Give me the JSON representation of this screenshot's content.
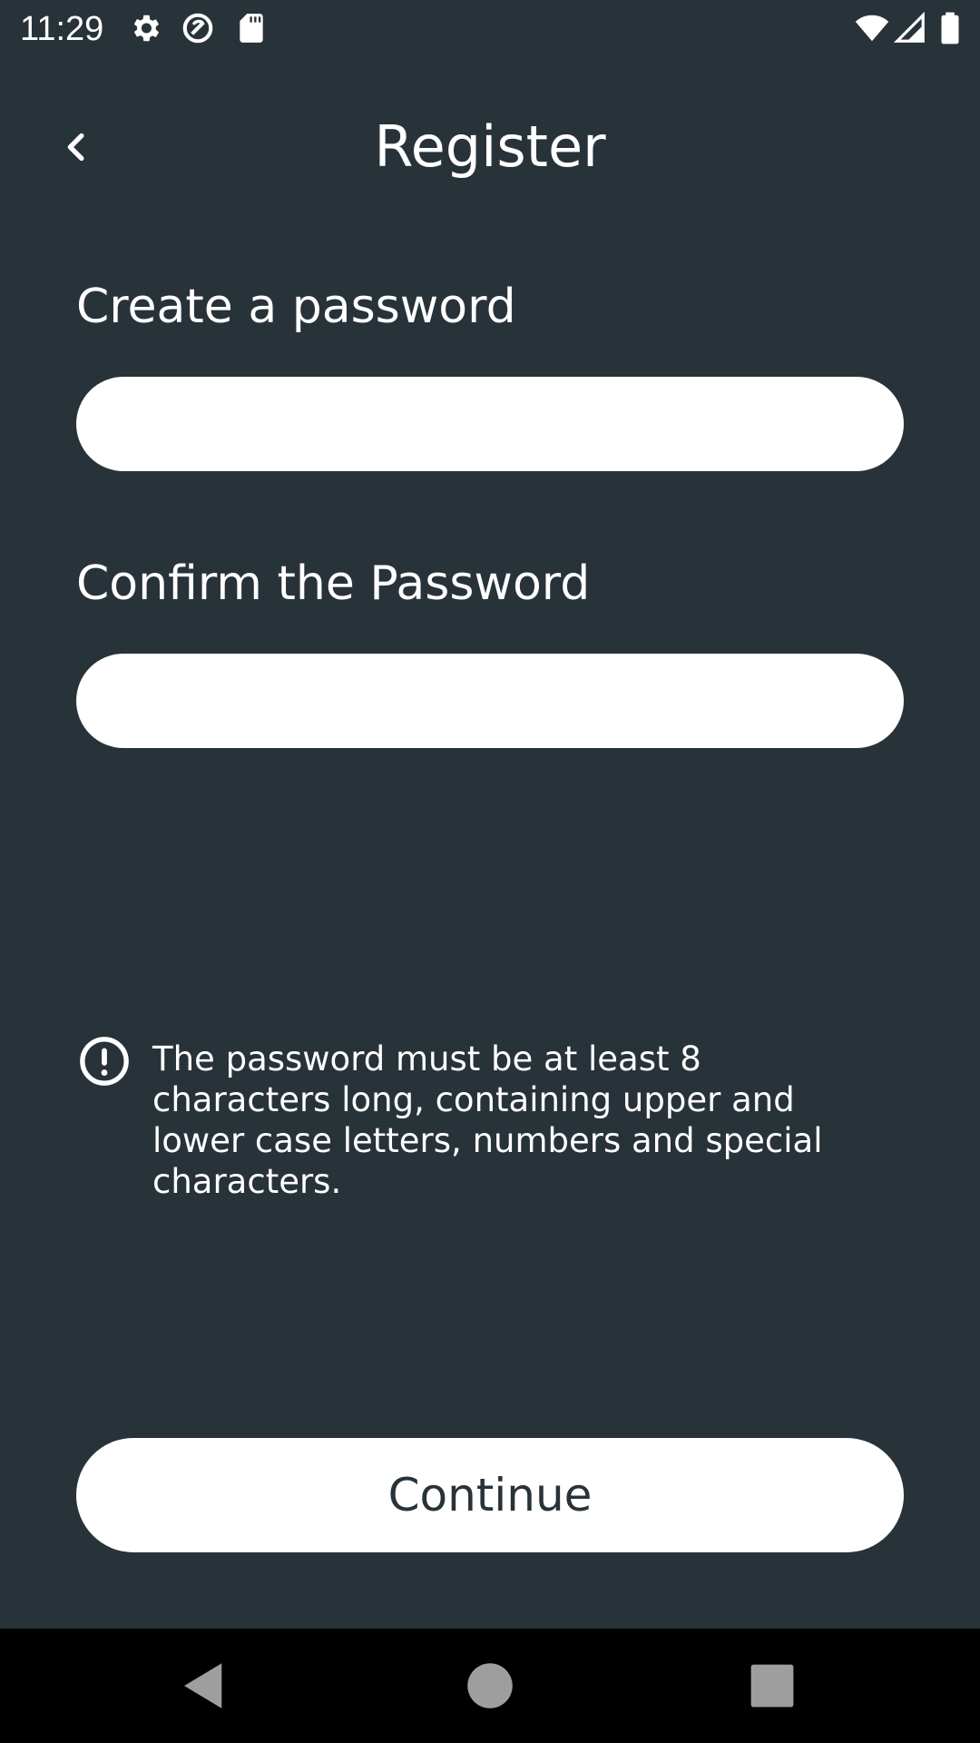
{
  "status_bar": {
    "time": "11:29",
    "icons": [
      "gear-icon",
      "sync-off-icon",
      "sd-card-icon",
      "wifi-icon",
      "cell-signal-icon",
      "battery-icon"
    ]
  },
  "header": {
    "title": "Register",
    "back_icon": "chevron-left-icon"
  },
  "form": {
    "password_label": "Create a password",
    "password_value": "",
    "password_placeholder": "",
    "confirm_label": "Confirm the Password",
    "confirm_value": "",
    "confirm_placeholder": ""
  },
  "note": {
    "icon": "alert-circle-icon",
    "text": "The password must be at least 8 characters long, containing upper and lower case letters, numbers and special characters."
  },
  "actions": {
    "continue_label": "Continue"
  },
  "nav_bar": {
    "icons": [
      "back-triangle-icon",
      "home-circle-icon",
      "recents-square-icon"
    ]
  },
  "colors": {
    "background": "#283239",
    "foreground": "#ffffff",
    "nav_background": "#000000",
    "nav_icon": "#9e9e9e"
  }
}
